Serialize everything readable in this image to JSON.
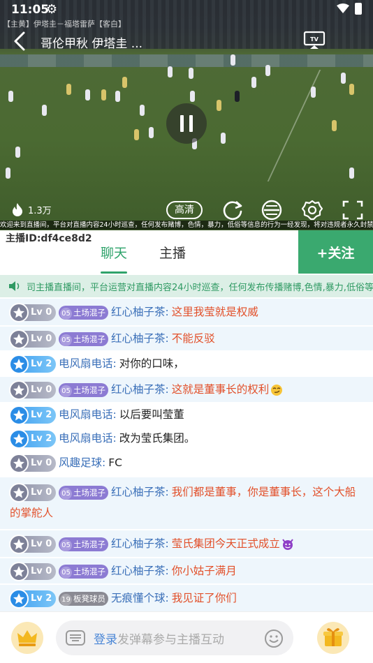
{
  "status": {
    "time": "11:05"
  },
  "video": {
    "room_strip": "【主黄】伊塔圭－福塔雷萨【客白】",
    "title": "哥伦甲秋  伊塔圭 ...",
    "views": "1.3万",
    "quality_label": "高清",
    "marquee": "欢迎来到直播间，平台对直播内容24小时巡查，任何发布赌博，色情，暴力，低俗等信息的行为一经发现，将对违规者永久封禁处理！",
    "playing": true
  },
  "anchor": {
    "id_label": "主播ID:df4ce8d2"
  },
  "tabs": [
    {
      "label": "聊天",
      "active": true
    },
    {
      "label": "主播",
      "active": false
    }
  ],
  "follow_label": "+关注",
  "notice": "司主播直播间，平台运营对直播内容24小时巡查，任何发布传播赌博,色情,暴力,低俗等",
  "messages": [
    {
      "level": "Lv 0",
      "level_color": "gray",
      "badge_num": "05",
      "badge": "土场混子",
      "badge_color": "purple",
      "user": "红心柚子茶:",
      "text": "这里我莹就是权威",
      "text_color": "red"
    },
    {
      "level": "Lv 0",
      "level_color": "gray",
      "badge_num": "05",
      "badge": "土场混子",
      "badge_color": "purple",
      "user": "红心柚子茶:",
      "text": "不能反驳",
      "text_color": "red"
    },
    {
      "level": "Lv 2",
      "level_color": "blue",
      "user": "电风扇电话:",
      "text": "对你的口味，",
      "text_color": "dark"
    },
    {
      "level": "Lv 0",
      "level_color": "gray",
      "badge_num": "05",
      "badge": "土场混子",
      "badge_color": "purple",
      "user": "红心柚子茶:",
      "text": "这就是董事长的权利",
      "text_color": "red",
      "emoji": "smirk"
    },
    {
      "level": "Lv 2",
      "level_color": "blue",
      "user": "电风扇电话:",
      "text": "以后要叫莹董",
      "text_color": "dark"
    },
    {
      "level": "Lv 2",
      "level_color": "blue",
      "user": "电风扇电话:",
      "text": "改为莹氏集团。",
      "text_color": "dark"
    },
    {
      "level": "Lv 0",
      "level_color": "gray",
      "user": "风趣足球:",
      "text": "FC",
      "text_color": "dark"
    },
    {
      "level": "Lv 0",
      "level_color": "gray",
      "badge_num": "05",
      "badge": "土场混子",
      "badge_color": "purple",
      "user": "红心柚子茶:",
      "text": "我们都是董事，你是董事长，这个大船",
      "text_cont": "的掌舵人",
      "text_color": "red"
    },
    {
      "level": "Lv 0",
      "level_color": "gray",
      "badge_num": "05",
      "badge": "土场混子",
      "badge_color": "purple",
      "user": "红心柚子茶:",
      "text": "莹氏集团今天正式成立",
      "text_color": "red",
      "emoji": "devil"
    },
    {
      "level": "Lv 0",
      "level_color": "gray",
      "badge_num": "05",
      "badge": "土场混子",
      "badge_color": "purple",
      "user": "红心柚子茶:",
      "text": "你小姑子满月",
      "text_color": "red"
    },
    {
      "level": "Lv 2",
      "level_color": "blue",
      "badge_num": "19",
      "badge": "板凳球员",
      "badge_color": "gray",
      "user": "无痕懂个球:",
      "text": "我见证了你们",
      "text_color": "red"
    }
  ],
  "input": {
    "login_label": "登录",
    "placeholder_rest": "发弹幕参与主播互动"
  },
  "colors": {
    "accent": "#3aa96f",
    "name_blue": "#3a6fb8",
    "message_red": "#e2502a"
  }
}
